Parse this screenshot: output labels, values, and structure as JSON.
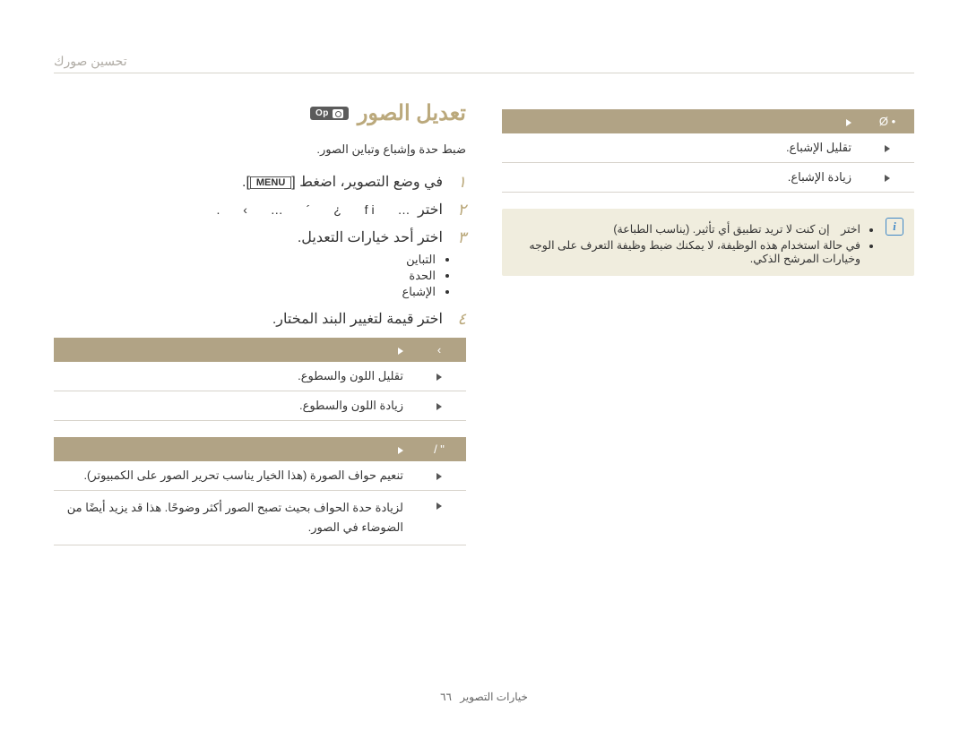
{
  "crumb": "تحسين صورك",
  "heading": "تعديل الصور",
  "mode_badge": "Op",
  "subtitle": "ضبط حدة وإشباع وتباين الصور.",
  "steps": {
    "1": {
      "pre": "في وضع التصوير، اضغط",
      "menu": "MENU",
      "post": "."
    },
    "2": {
      "pre": "اختر",
      "glyphs": "…  fi  ¿  ´  …  ›  ."
    },
    "3": "اختر أحد خيارات التعديل.",
    "4": "اختر قيمة لتغيير البند المختار."
  },
  "adjust_options": [
    "التباين",
    "الحدة",
    "الإشباع"
  ],
  "table_contrast": {
    "header_icon": "›",
    "header_desc": "»",
    "rows": [
      {
        "icon": "-",
        "desc": "تقليل اللون والسطوع."
      },
      {
        "icon": "+",
        "desc": "زيادة اللون والسطوع."
      }
    ]
  },
  "table_sharpness": {
    "header_icon": "\" /",
    "header_desc": "»",
    "rows": [
      {
        "icon": "-",
        "desc": "تنعيم حواف الصورة (هذا الخيار يناسب تحرير الصور على الكمبيوتر)."
      },
      {
        "icon": "+",
        "desc": "لزيادة حدة الحواف بحيث تصبح الصور أكثر وضوحًا. هذا قد يزيد أيضًا من الضوضاء في الصور."
      }
    ]
  },
  "table_saturation": {
    "header_icon": "• Ø",
    "header_desc": "»",
    "rows": [
      {
        "icon": "-",
        "desc": "تقليل الإشباع."
      },
      {
        "icon": "+",
        "desc": "زيادة الإشباع."
      }
    ]
  },
  "notes": [
    "اختر　إن كنت لا تريد تطبيق أي تأثير. (يناسب الطباعة)",
    "في حالة استخدام هذه الوظيفة، لا يمكنك ضبط وظيفة التعرف على الوجه وخيارات المرشح الذكي."
  ],
  "footer": {
    "label": "خيارات التصوير",
    "page": "٦٦"
  }
}
